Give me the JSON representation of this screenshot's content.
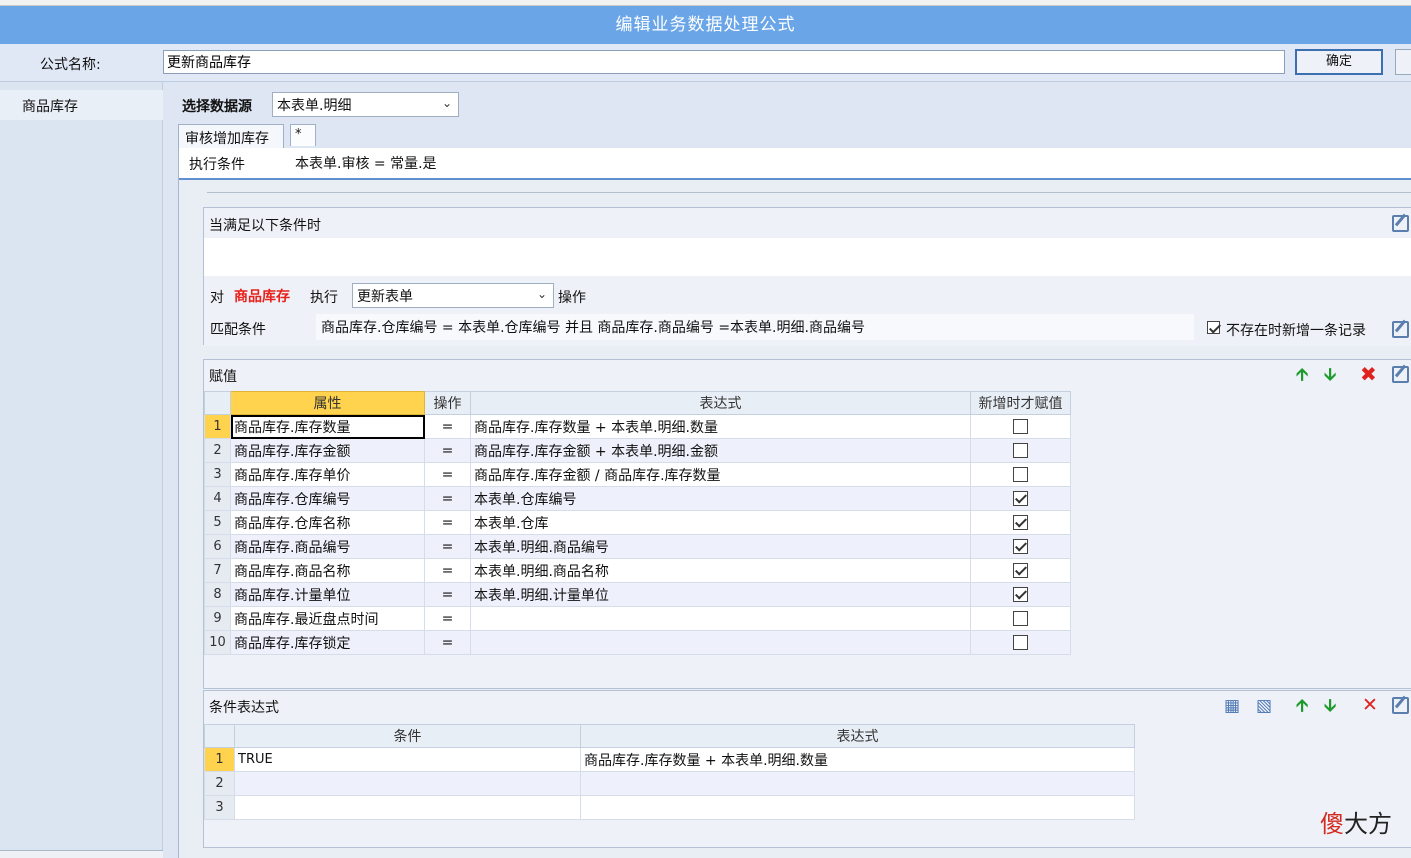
{
  "window": {
    "title": "编辑业务数据处理公式"
  },
  "formula": {
    "name_label": "公式名称:",
    "name_value": "更新商品库存",
    "ok_label": "确定"
  },
  "sidebar": {
    "items": [
      {
        "label": "商品库存"
      }
    ]
  },
  "datasource": {
    "label": "选择数据源",
    "selected": "本表单.明细"
  },
  "tabs": [
    {
      "label": "审核增加库存"
    },
    {
      "label": "*"
    }
  ],
  "exec": {
    "label": "执行条件",
    "value": "本表单.审核 = 常量.是"
  },
  "condition": {
    "header": "当满足以下条件时",
    "dui": "对",
    "target": "商品库存",
    "exec_word": "执行",
    "action": "更新表单",
    "op_word": "操作",
    "match_label": "匹配条件",
    "match_value": "商品库存.仓库编号 = 本表单.仓库编号 并且 商品库存.商品编号 =本表单.明细.商品编号",
    "add_if_missing_label": "不存在时新增一条记录",
    "add_if_missing": true
  },
  "assign": {
    "header": "赋值",
    "columns": [
      "属性",
      "操作",
      "表达式",
      "新增时才赋值"
    ],
    "rows": [
      {
        "n": "1",
        "attr": "商品库存.库存数量",
        "op": "=",
        "expr": "商品库存.库存数量 + 本表单.明细.数量",
        "on_add": false
      },
      {
        "n": "2",
        "attr": "商品库存.库存金额",
        "op": "=",
        "expr": "商品库存.库存金额 + 本表单.明细.金额",
        "on_add": false
      },
      {
        "n": "3",
        "attr": "商品库存.库存单价",
        "op": "=",
        "expr": "商品库存.库存金额 / 商品库存.库存数量",
        "on_add": false
      },
      {
        "n": "4",
        "attr": "商品库存.仓库编号",
        "op": "=",
        "expr": "本表单.仓库编号",
        "on_add": true
      },
      {
        "n": "5",
        "attr": "商品库存.仓库名称",
        "op": "=",
        "expr": "本表单.仓库",
        "on_add": true
      },
      {
        "n": "6",
        "attr": "商品库存.商品编号",
        "op": "=",
        "expr": "本表单.明细.商品编号",
        "on_add": true
      },
      {
        "n": "7",
        "attr": "商品库存.商品名称",
        "op": "=",
        "expr": "本表单.明细.商品名称",
        "on_add": true
      },
      {
        "n": "8",
        "attr": "商品库存.计量单位",
        "op": "=",
        "expr": "本表单.明细.计量单位",
        "on_add": true
      },
      {
        "n": "9",
        "attr": "商品库存.最近盘点时间",
        "op": "=",
        "expr": "",
        "on_add": false
      },
      {
        "n": "10",
        "attr": "商品库存.库存锁定",
        "op": "=",
        "expr": "",
        "on_add": false
      }
    ]
  },
  "condexpr": {
    "header": "条件表达式",
    "columns": [
      "条件",
      "表达式"
    ],
    "rows": [
      {
        "n": "1",
        "cond": "TRUE",
        "expr": "商品库存.库存数量 + 本表单.明细.数量"
      },
      {
        "n": "2",
        "cond": "",
        "expr": ""
      },
      {
        "n": "3",
        "cond": "",
        "expr": ""
      }
    ]
  },
  "watermark": {
    "part1": "傻",
    "part2": "大方"
  },
  "colors": {
    "titlebar": "#6aa5e8",
    "target_red": "#e8201a",
    "selected_header": "#ffd34e"
  },
  "icons": [
    "edit-icon",
    "up-arrow-icon",
    "down-arrow-icon",
    "delete-icon",
    "add-row-icon",
    "insert-row-icon",
    "chevron-down-icon"
  ]
}
